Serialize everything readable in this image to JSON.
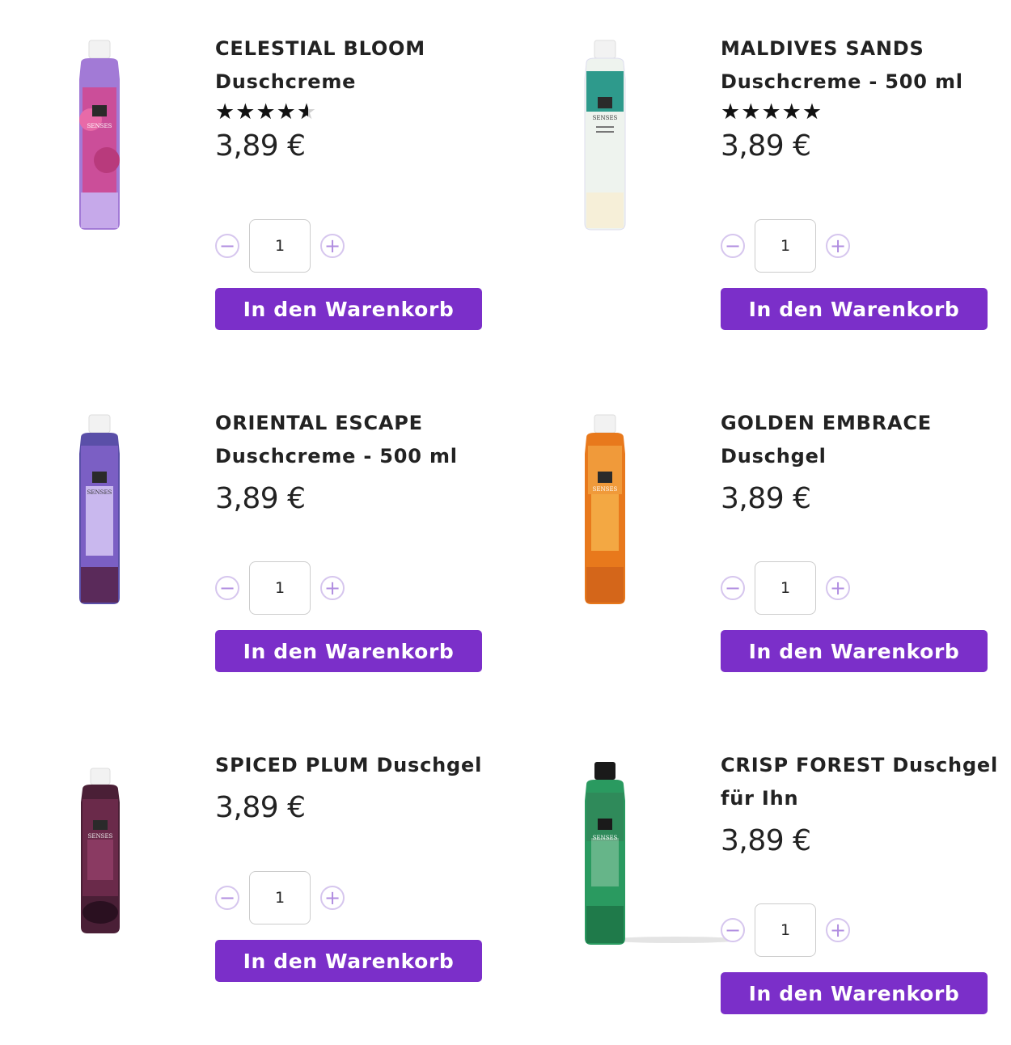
{
  "products": [
    {
      "title_line1": "CELESTIAL BLOOM",
      "title_line2": "Duschcreme",
      "rating": 4.5,
      "price": "3,89 €",
      "quantity": "1",
      "cart_label": "In den Warenkorb",
      "bottle": {
        "cap": "#f2f2f2",
        "top": "#c8a6e8",
        "body": "#a27ad6",
        "label": "#d2468e",
        "label_text": "SENSES"
      }
    },
    {
      "title_line1": "MALDIVES SANDS",
      "title_line2": "Duschcreme - 500 ml",
      "rating": 5,
      "price": "3,89 €",
      "quantity": "1",
      "cart_label": "In den Warenkorb",
      "bottle": {
        "cap": "#f2f2f2",
        "top": "#2e9a8c",
        "body": "#eef3ee",
        "label": "#ffffff",
        "label_text": "SENSES"
      }
    },
    {
      "title_line1": "ORIENTAL ESCAPE",
      "title_line2": "Duschcreme - 500 ml",
      "price": "3,89 €",
      "quantity": "1",
      "cart_label": "In den Warenkorb",
      "bottle": {
        "cap": "#f2f2f2",
        "top": "#7b5fc4",
        "body": "#5a4fa8",
        "label": "#c9b8ee",
        "label_text": "SENSES"
      }
    },
    {
      "title_line1": "GOLDEN EMBRACE",
      "title_line2": "Duschgel",
      "price": "3,89 €",
      "quantity": "1",
      "cart_label": "In den Warenkorb",
      "bottle": {
        "cap": "#f2f2f2",
        "top": "#f09a3a",
        "body": "#e8791c",
        "label": "#f4b04a",
        "label_text": "SENSES"
      }
    },
    {
      "title_line1": "SPICED PLUM Duschgel",
      "price": "3,89 €",
      "quantity": "1",
      "cart_label": "In den Warenkorb",
      "bottle": {
        "cap": "#f2f2f2",
        "top": "#6a2a4a",
        "body": "#4a1f36",
        "label": "#8a3a62",
        "label_text": "SENSES"
      }
    },
    {
      "title_line1": "CRISP FOREST Duschgel",
      "title_line2": "für Ihn",
      "price": "3,89 €",
      "quantity": "1",
      "cart_label": "In den Warenkorb",
      "bottle": {
        "cap": "#1a1a1a",
        "top": "#2f8a5a",
        "body": "#2a9a60",
        "label": "#d8e8d6",
        "label_text": "SENSES"
      }
    }
  ],
  "icons": {
    "minus": "minus-circle-icon",
    "plus": "plus-circle-icon",
    "star": "star-icon"
  },
  "colors": {
    "accent": "#7b2fc9",
    "stepper": "#b08de0"
  }
}
